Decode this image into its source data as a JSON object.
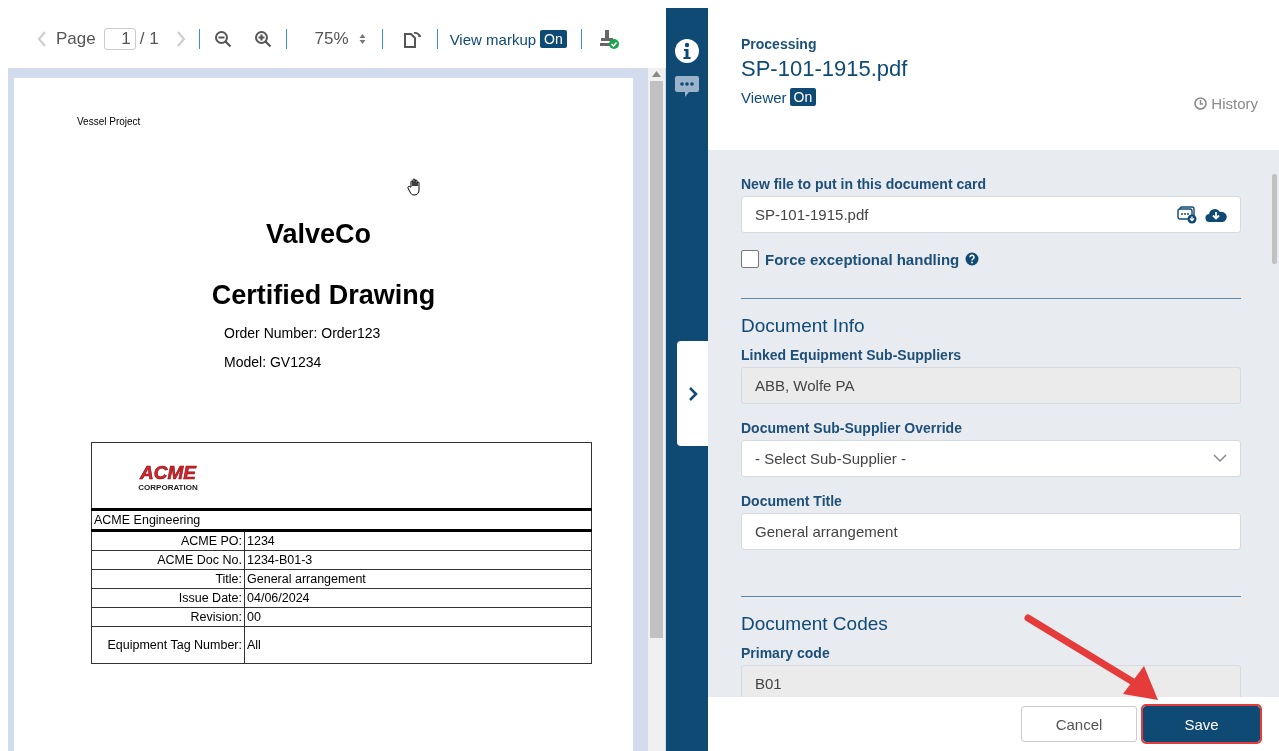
{
  "toolbar": {
    "page_label": "Page",
    "page_value": "1",
    "page_total": "/ 1",
    "zoom": "75%",
    "view_markup_label": "View markup",
    "view_markup": "On"
  },
  "document": {
    "header": "Vessel Project",
    "company": "ValveCo",
    "title": "Certified Drawing",
    "lines": [
      "Order Number: Order123",
      "Model: GV1234"
    ],
    "logo": {
      "name": "ACME",
      "subtitle": "CORPORATION"
    },
    "table_heading": "ACME Engineering",
    "rows": [
      {
        "label": "ACME PO:",
        "value": "1234"
      },
      {
        "label": "ACME Doc No.",
        "value": "1234-B01-3"
      },
      {
        "label": "Title:",
        "value": "General arrangement"
      },
      {
        "label": "Issue Date:",
        "value": "04/06/2024"
      },
      {
        "label": "Revision:",
        "value": "00"
      },
      {
        "label": "Equipment Tag Number:",
        "value": "All"
      }
    ]
  },
  "rail": {
    "items": [
      {
        "kind": "info",
        "selected": true
      },
      {
        "kind": "comments",
        "selected": false
      }
    ]
  },
  "panel": {
    "status": "Processing",
    "filename": "SP-101-1915.pdf",
    "viewer_label": "Viewer",
    "viewer_badge": "On",
    "history": "History"
  },
  "form": {
    "file_label": "New file to put in this document card",
    "file_value": "SP-101-1915.pdf",
    "force_label": "Force exceptional handling",
    "force_checked": false,
    "sections": [
      {
        "heading": "Document Info",
        "fields": [
          {
            "kind": "readonly",
            "label": "Linked Equipment Sub-Suppliers",
            "value": "ABB, Wolfe PA"
          },
          {
            "kind": "select",
            "label": "Document Sub-Supplier Override",
            "value": "- Select Sub-Supplier -"
          },
          {
            "kind": "text",
            "label": "Document Title",
            "value": "General arrangement"
          }
        ]
      },
      {
        "heading": "Document Codes",
        "fields": [
          {
            "kind": "readonly",
            "label": "Primary code",
            "value": "B01"
          }
        ]
      }
    ]
  },
  "buttons": [
    {
      "kind": "secondary",
      "label": "Cancel",
      "highlighted": false
    },
    {
      "kind": "primary",
      "label": "Save",
      "highlighted": true
    }
  ]
}
